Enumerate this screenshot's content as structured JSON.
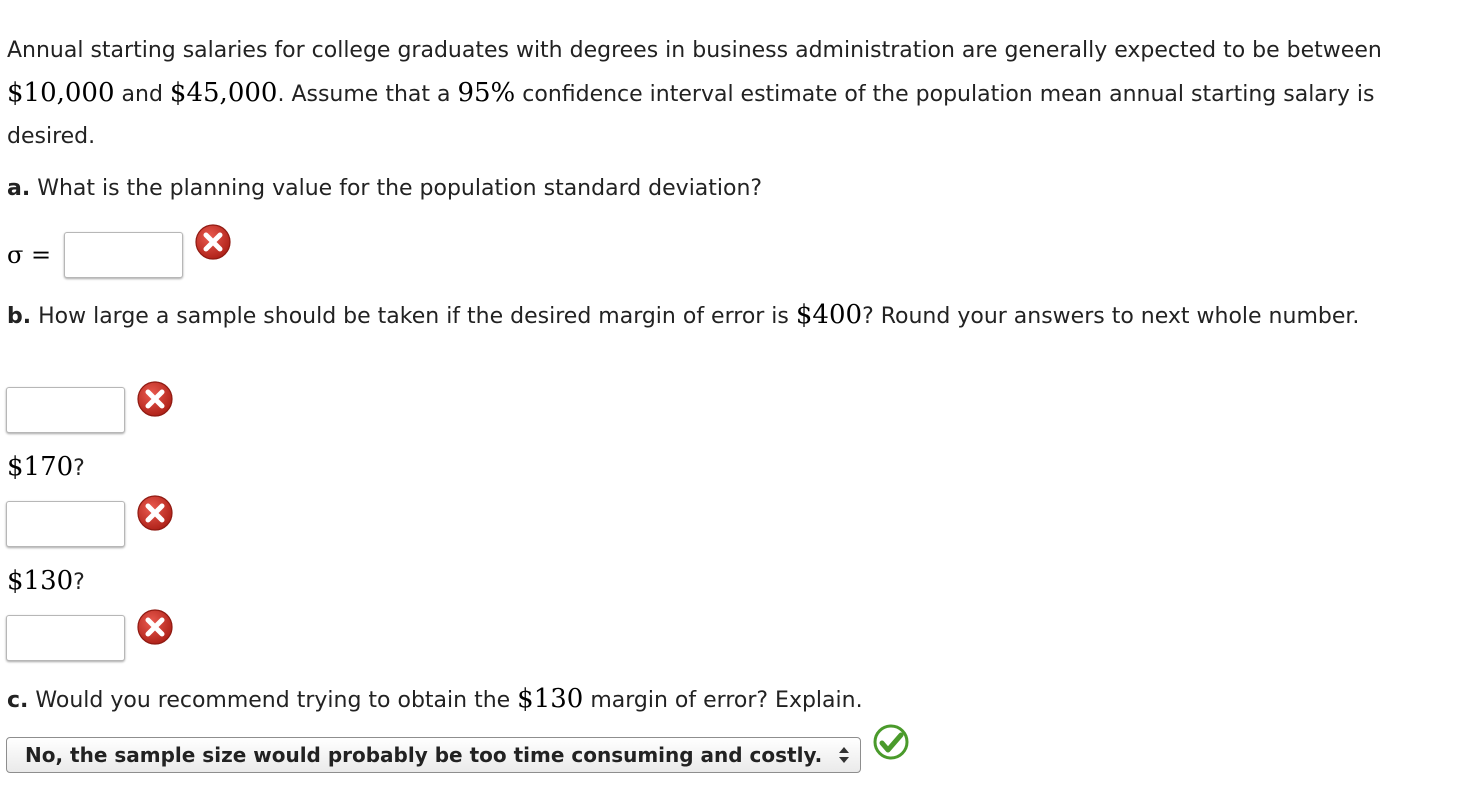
{
  "intro": {
    "t1": "Annual starting salaries for college graduates with degrees in business administration are generally expected to be",
    "t2": "between ",
    "m_low": "$10,000",
    "t3": " and ",
    "m_high": "$45,000",
    "t4": ". Assume that a ",
    "m_conf": "95%",
    "t5": " confidence interval estimate of the population mean annual starting salary is desired."
  },
  "part_a": {
    "letter": "a.",
    "question": " What is the planning value for the population standard deviation?",
    "sigma_label": "σ =",
    "value": "",
    "status_icon": "x-circle-icon"
  },
  "part_b": {
    "letter": "b.",
    "q1": " How large a sample should be taken if the desired margin of error is ",
    "m_400": "$400",
    "q2": "? Round your answers to next whole number.",
    "value_400": "",
    "m_170": "$170",
    "q_170": "?",
    "value_170": "",
    "m_130": "$130",
    "q_130": "?",
    "value_130": "",
    "status_icon": "x-circle-icon"
  },
  "part_c": {
    "letter": "c.",
    "q1": " Would you recommend trying to obtain the ",
    "m_130": "$130",
    "q2": " margin of error? Explain.",
    "selected": "No, the sample size would probably be too time consuming and costly.",
    "status_icon": "check-circle-icon"
  },
  "colors": {
    "x_red": "#c0271d",
    "check_green": "#4a9a2b"
  }
}
